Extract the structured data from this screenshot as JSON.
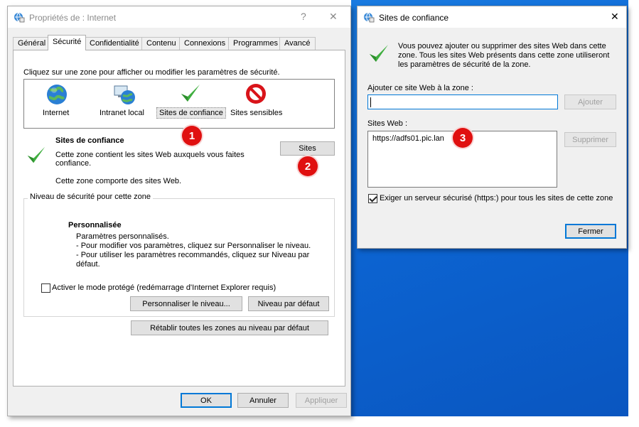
{
  "main_dialog": {
    "title": "Propriétés de : Internet",
    "help_symbol": "?",
    "close_symbol": "✕",
    "tabs": [
      "Général",
      "Sécurité",
      "Confidentialité",
      "Contenu",
      "Connexions",
      "Programmes",
      "Avancé"
    ],
    "active_tab": "Sécurité",
    "instruction": "Cliquez sur une zone pour afficher ou modifier les paramètres de sécurité.",
    "zones": [
      {
        "label": "Internet",
        "icon": "globe-icon"
      },
      {
        "label": "Intranet local",
        "icon": "network-globe-icon"
      },
      {
        "label": "Sites de confiance",
        "icon": "green-check-icon",
        "selected": true
      },
      {
        "label": "Sites sensibles",
        "icon": "restricted-icon"
      }
    ],
    "zone_info": {
      "title": "Sites de confiance",
      "desc_line1": "Cette zone contient les sites Web auxquels vous faites",
      "desc_line2": "confiance.",
      "desc_line3": "Cette zone comporte des sites Web."
    },
    "sites_button": "Sites",
    "security_level": {
      "group_title": "Niveau de sécurité pour cette zone",
      "level_name": "Personnalisée",
      "line1": "Paramètres personnalisés.",
      "line2": "- Pour modifier vos paramètres, cliquez sur Personnaliser le niveau.",
      "line3": "- Pour utiliser les paramètres recommandés, cliquez sur Niveau par",
      "line4": "défaut."
    },
    "protected_mode_label": "Activer le mode protégé (redémarrage d'Internet Explorer requis)",
    "protected_mode_checked": false,
    "customize_button": "Personnaliser le niveau...",
    "default_level_button": "Niveau par défaut",
    "reset_all_button": "Rétablir toutes les zones au niveau par défaut",
    "ok_button": "OK",
    "cancel_button": "Annuler",
    "apply_button": "Appliquer"
  },
  "trusted_sites_dialog": {
    "title": "Sites de confiance",
    "close_symbol": "✕",
    "info_line1": "Vous pouvez ajouter ou supprimer des sites Web dans cette",
    "info_line2": "zone. Tous les sites Web présents dans cette zone utiliseront",
    "info_line3": "les paramètres de sécurité de la zone.",
    "add_label": "Ajouter ce site Web à la zone :",
    "add_input_value": "",
    "add_button": "Ajouter",
    "sites_label": "Sites Web :",
    "sites": [
      "https://adfs01.pic.lan"
    ],
    "remove_button": "Supprimer",
    "require_https_label": "Exiger un serveur sécurisé (https:) pour tous les sites de cette zone",
    "require_https_checked": true,
    "close_button": "Fermer"
  },
  "annotations": [
    "1",
    "2",
    "3"
  ],
  "colors": {
    "accent": "#0078d7",
    "badge_red": "#e01010",
    "desktop_blue": "#0c66d4",
    "check_green": "#3fae3f"
  }
}
